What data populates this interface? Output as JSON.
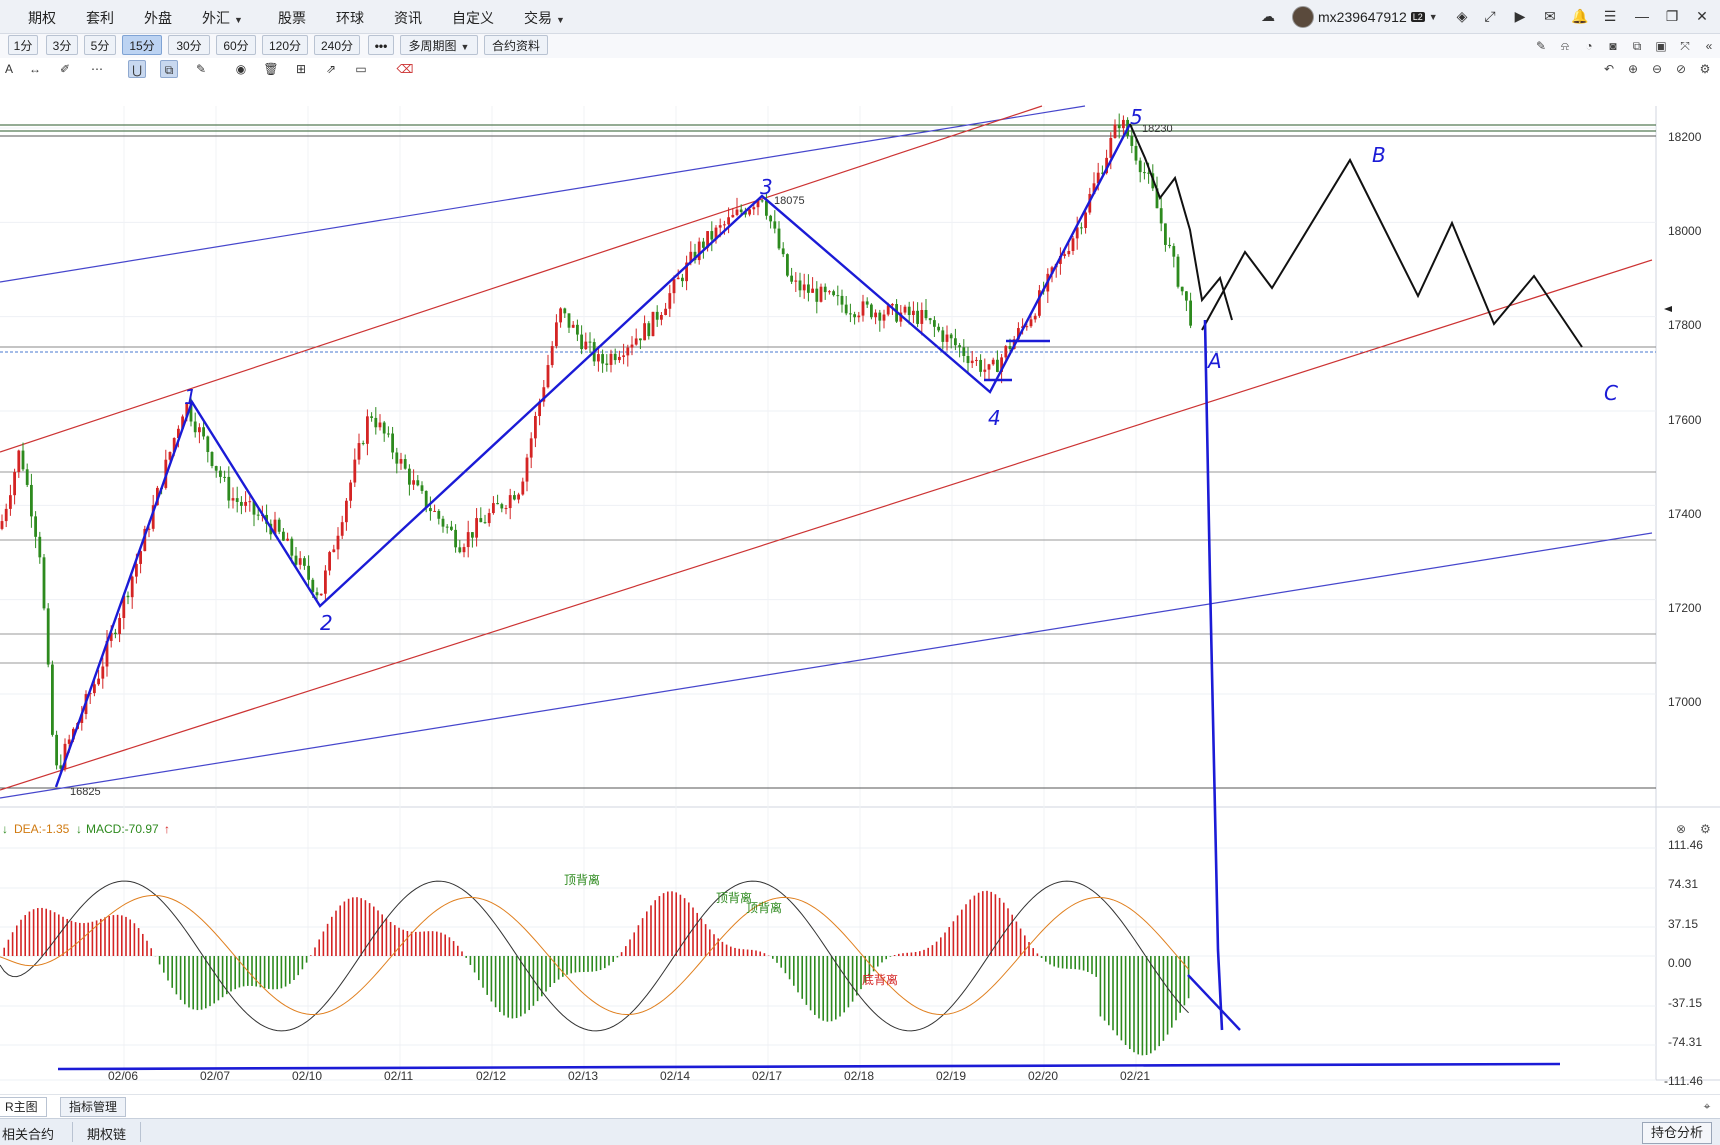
{
  "menu": {
    "items": [
      {
        "label": "期权",
        "caret": false
      },
      {
        "label": "套利",
        "caret": false
      },
      {
        "label": "外盘",
        "caret": false
      },
      {
        "label": "外汇",
        "caret": true
      },
      {
        "label": "股票",
        "caret": false
      },
      {
        "label": "环球",
        "caret": false
      },
      {
        "label": "资讯",
        "caret": false
      },
      {
        "label": "自定义",
        "caret": false
      },
      {
        "label": "交易",
        "caret": true
      }
    ],
    "username": "mx239647912",
    "badge": "L2"
  },
  "timeframes": {
    "buttons": [
      "1分",
      "3分",
      "5分",
      "15分",
      "30分",
      "60分",
      "120分",
      "240分"
    ],
    "active": "15分",
    "more": "•••",
    "multi_period": "多周期图",
    "contract_info": "合约资料"
  },
  "drawing_toolbar": {
    "text_tool": "A"
  },
  "price_axis": {
    "ticks": [
      "18200",
      "18000",
      "17800",
      "17600",
      "17400",
      "17200",
      "17000"
    ]
  },
  "annotations": {
    "high_label": "18230",
    "peak3_label": "18075",
    "low_label": "16825"
  },
  "macd": {
    "dea_label": "DEA:-1.35",
    "macd_label": "MACD:-70.97",
    "axis_ticks": [
      "111.46",
      "74.31",
      "37.15",
      "0.00",
      "-37.15",
      "-74.31",
      "-111.46"
    ],
    "divergence_labels": [
      "顶背离",
      "顶背离",
      "顶背离",
      "底背离"
    ]
  },
  "date_axis": {
    "dates": [
      "02/06",
      "02/07",
      "02/10",
      "02/11",
      "02/12",
      "02/13",
      "02/14",
      "02/17",
      "02/18",
      "02/19",
      "02/20",
      "02/21"
    ]
  },
  "bottom_tabs": {
    "main": "R主图",
    "indicator": "指标管理"
  },
  "statusbar": {
    "related": "相关合约",
    "option_chain": "期权链",
    "position_analysis": "持仓分析"
  },
  "colors": {
    "up": "#d42424",
    "down": "#2d8a1e",
    "wave": "#1b1bd6",
    "channel_red": "#cc3333",
    "channel_blue": "#4646cc"
  }
}
